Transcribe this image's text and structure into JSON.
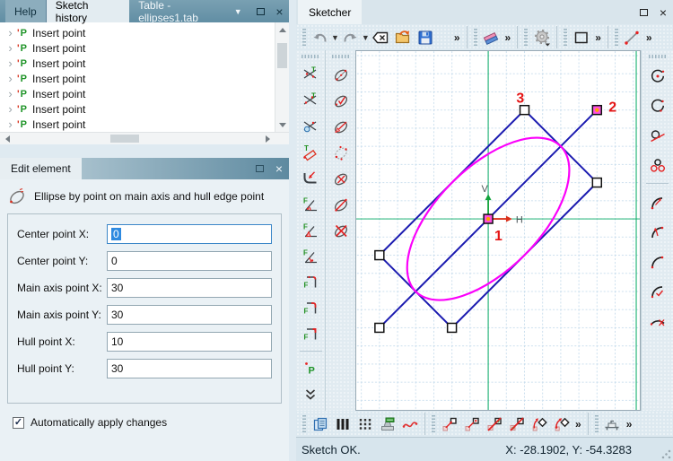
{
  "left": {
    "tabs": {
      "help": "Help",
      "history": "Sketch history",
      "table": "Table - ellipses1.tab"
    },
    "tree": {
      "items": [
        "Insert point",
        "Insert point",
        "Insert point",
        "Insert point",
        "Insert point",
        "Insert point",
        "Insert point"
      ]
    },
    "edit": {
      "title": "Edit element",
      "description": "Ellipse by point on main axis and hull edge point",
      "fields": [
        {
          "label": "Center point X:",
          "value": "0"
        },
        {
          "label": "Center point Y:",
          "value": "0"
        },
        {
          "label": "Main axis point X:",
          "value": "30"
        },
        {
          "label": "Main axis point Y:",
          "value": "30"
        },
        {
          "label": "Hull point X:",
          "value": "10"
        },
        {
          "label": "Hull point Y:",
          "value": "30"
        }
      ],
      "auto_apply_label": "Automatically apply changes",
      "auto_apply_checked": true
    }
  },
  "sketcher": {
    "tab": "Sketcher",
    "toolbars": {
      "top": [
        "grip",
        "undo",
        "caret",
        "redo",
        "caret",
        "backspace",
        "open",
        "save",
        "gap",
        "ovf",
        "sep",
        "grip",
        "eraser",
        "ovf",
        "sep",
        "grip",
        "gear",
        "sep",
        "grip",
        "rect",
        "ovf",
        "sep",
        "grip",
        "line",
        "ovf"
      ],
      "left_col1": [
        "griph",
        "tan1",
        "tan2",
        "tanc",
        "tanr",
        "fillet",
        "fang1",
        "fang2",
        "fang3",
        "fcor1",
        "fcor2",
        "fcor3",
        "seph",
        "point",
        "more"
      ],
      "left_col2": [
        "griph",
        "ell1",
        "ell2",
        "ell3",
        "ell4",
        "ell5",
        "ell6",
        "ell7"
      ],
      "right_col": [
        "griph",
        "ccen",
        "circ",
        "ctan",
        "c3",
        "seph",
        "arc1",
        "arc2",
        "arc3",
        "arc4",
        "arc5"
      ],
      "bottom": [
        "grip",
        "pages",
        "bars",
        "barsd",
        "stamp",
        "spline",
        "sep",
        "grip",
        "sqa1",
        "sqa2",
        "sqx1",
        "sqx2",
        "rot1",
        "rot2",
        "ovf",
        "sep",
        "grip",
        "bed",
        "ovf"
      ]
    },
    "canvas": {
      "point_labels": {
        "p1": "1",
        "p2": "2",
        "p3": "3"
      },
      "axis_labels": {
        "v": "V",
        "h": "H"
      },
      "geometry": {
        "center": [
          0,
          0
        ],
        "main_axis_point": [
          30,
          30
        ],
        "hull_point": [
          10,
          30
        ],
        "grid_step": 5
      }
    },
    "status": {
      "message": "Sketch OK.",
      "coordinates": "X: -28.1902, Y: -54.3283"
    }
  },
  "colors": {
    "geometry_blue": "#1b1bb0",
    "ellipse_magenta": "#fb00fb",
    "axis_green": "#00a862",
    "label_red": "#e41414",
    "selection_blue": "#2e8ae0",
    "selected_handle": "#fd4fe3",
    "handle_dot_orange": "#ffa200"
  }
}
